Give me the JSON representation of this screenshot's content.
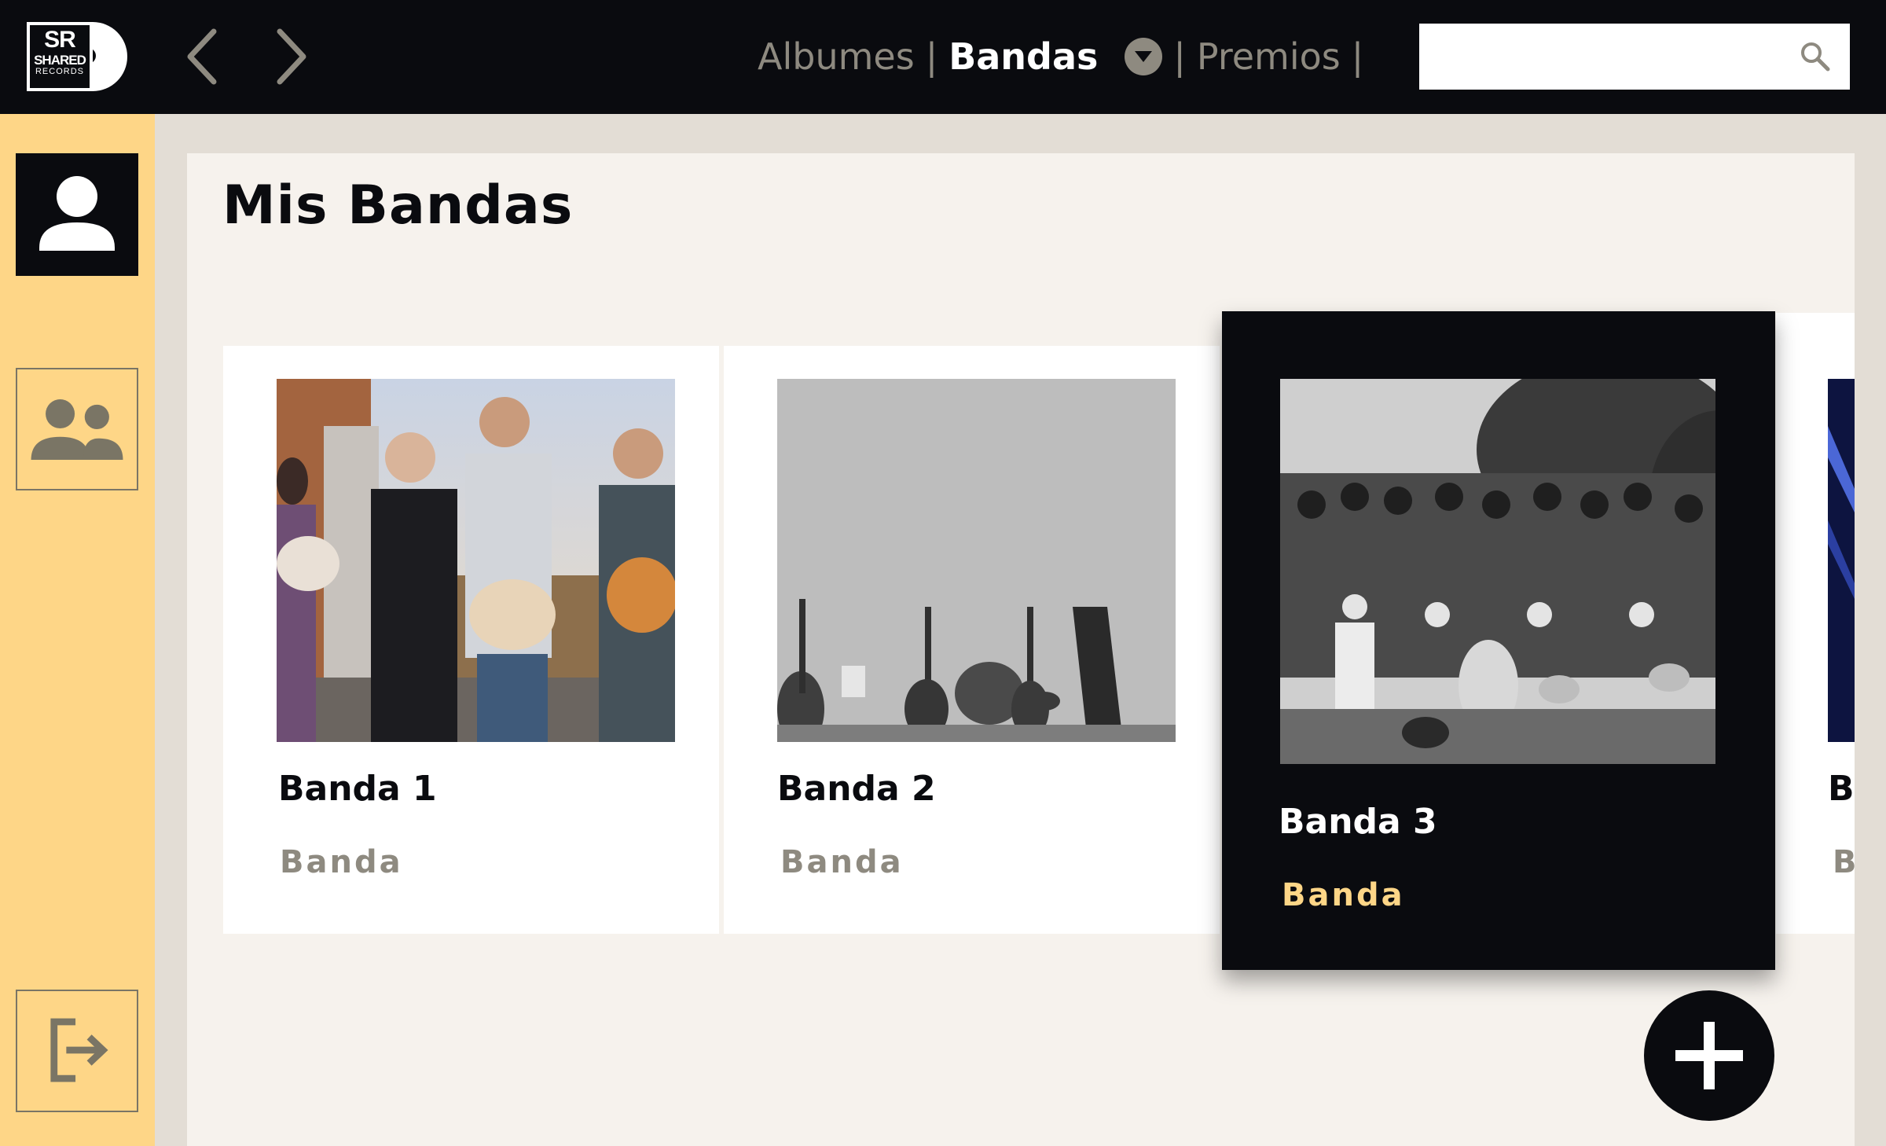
{
  "brand": {
    "logo_text": [
      "SR",
      "SHARED",
      "RECORDS"
    ]
  },
  "nav": {
    "back_icon": "chevron-left-icon",
    "forward_icon": "chevron-right-icon",
    "links": [
      {
        "label": "Albumes",
        "active": false
      },
      {
        "label": "Bandas",
        "active": true
      },
      {
        "label": "Premios",
        "active": false
      }
    ],
    "separator": "|",
    "dropdown_icon": "caret-down-circle-icon"
  },
  "search": {
    "value": "",
    "placeholder": "",
    "icon": "search-icon"
  },
  "sidebar": {
    "items": [
      {
        "name": "profile",
        "icon": "user-icon",
        "active": true
      },
      {
        "name": "bands",
        "icon": "group-icon",
        "active": false
      },
      {
        "name": "logout",
        "icon": "logout-icon",
        "active": false
      }
    ]
  },
  "main": {
    "title": "Mis Bandas",
    "cards": [
      {
        "name": "Banda 1",
        "type": "Banda",
        "selected": false
      },
      {
        "name": "Banda 2",
        "type": "Banda",
        "selected": false
      },
      {
        "name": "Banda 3",
        "type": "Banda",
        "selected": true
      },
      {
        "name": "B",
        "type": "B",
        "selected": false
      }
    ],
    "add_icon": "plus-icon"
  },
  "colors": {
    "topbar": "#0a0b0f",
    "sidebar": "#fed687",
    "panel": "#f6f2ed",
    "accent": "#fed687",
    "muted": "#8e8a80"
  }
}
